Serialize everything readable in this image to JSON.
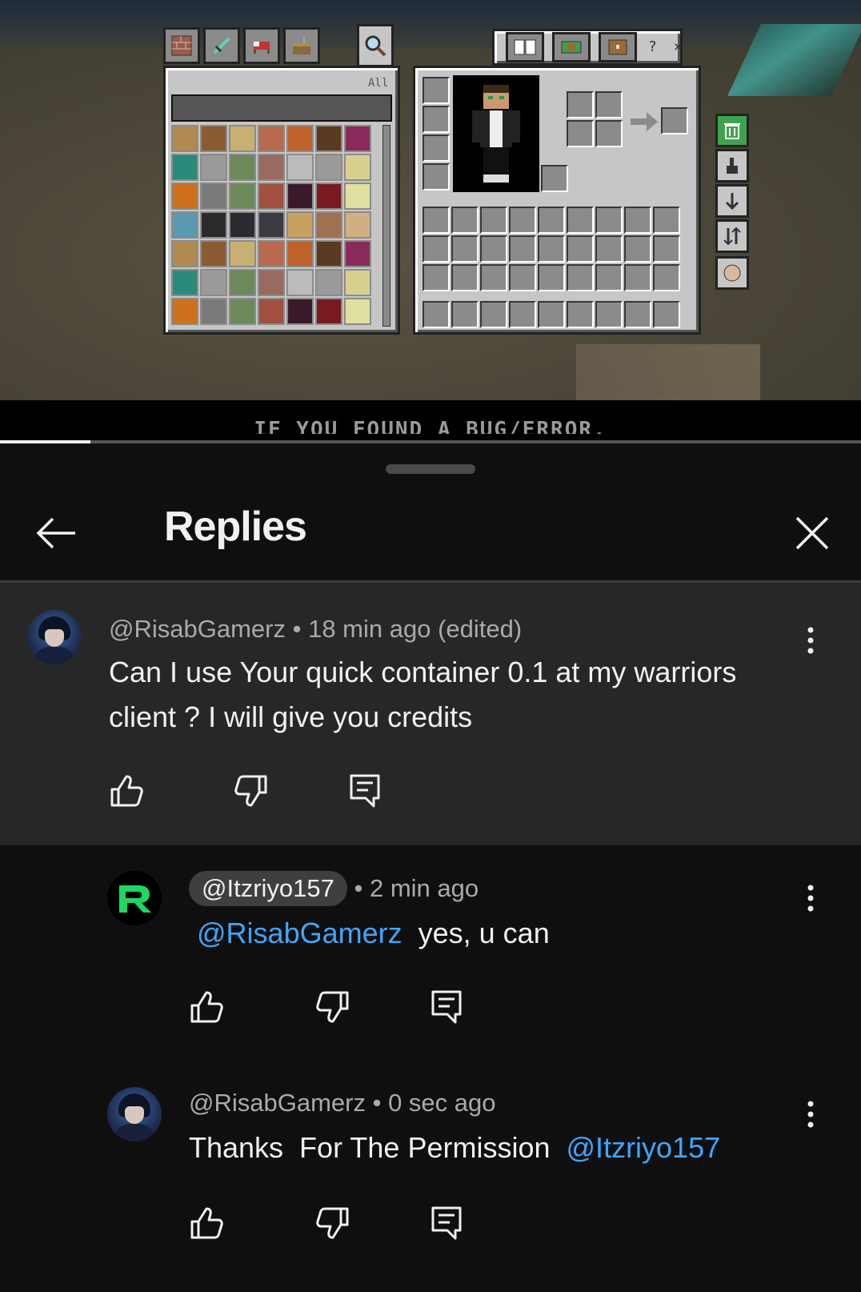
{
  "video": {
    "caption": "IF YOU FOUND A BUG/ERROR,",
    "progress_percent": 10.5,
    "inventory": {
      "filter_label": "All",
      "tab_icons": [
        "bricks-icon",
        "sword-icon",
        "bed-icon",
        "crafting-icon",
        "search-icon"
      ],
      "right_tab_icons": [
        "book-icon",
        "chest-minecart-icon",
        "chest-icon"
      ],
      "help_label": "?",
      "close_label": "×",
      "side_buttons": [
        "trash-icon",
        "pointer-icon",
        "arrow-down-icon",
        "sort-icon",
        "skin-icon"
      ]
    }
  },
  "sheet": {
    "title": "Replies",
    "parent": {
      "handle": "@RisabGamerz",
      "time": "18 min ago (edited)",
      "text_line1": "Can I use Your quick container 0.1 at my warriors",
      "text_line2": "client ? I will give you credits"
    },
    "replies": [
      {
        "handle": "@Itzriyo157",
        "time": "2 min ago",
        "mention": "@RisabGamerz",
        "text": "yes, u can"
      },
      {
        "handle": "@RisabGamerz",
        "time": "0 sec ago",
        "text": "Thanks  For The Permission",
        "mention": "@Itzriyo157"
      }
    ],
    "separator": "•"
  },
  "colors": {
    "background": "#0f0f0f",
    "parent_bg": "#272727",
    "mention": "#3ea6ff",
    "meta_text": "#aaaaaa",
    "logo_green": "#1ed760"
  }
}
